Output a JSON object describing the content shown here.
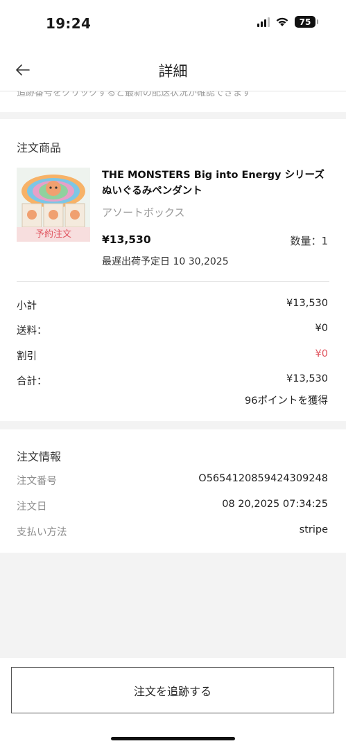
{
  "status_bar": {
    "time": "19:24",
    "battery": "75"
  },
  "nav": {
    "title": "詳細"
  },
  "peek_text": "追跡番号をクリックすると最新の配送状況が確認できます",
  "products": {
    "section_title": "注文商品",
    "item": {
      "name": "THE MONSTERS Big into Energy シリーズ ぬいぐるみペンダント",
      "variant": "アソートボックス",
      "badge": "予約注文",
      "price": "¥13,530",
      "quantity": "数量：1",
      "ship_date": "最遅出荷予定日 10 30,2025"
    },
    "summary": {
      "subtotal_label": "小計",
      "subtotal": "¥13,530",
      "shipping_label": "送料：",
      "shipping": "¥0",
      "discount_label": "割引",
      "discount": "¥0",
      "total_label": "合計：",
      "total": "¥13,530",
      "points": "96ポイントを獲得"
    }
  },
  "order_info": {
    "section_title": "注文情報",
    "rows": [
      {
        "label": "注文番号",
        "value": "O565412085942430924​8"
      },
      {
        "label": "注文日",
        "value": "08 20,2025 07:34:25"
      },
      {
        "label": "支払い方法",
        "value": "stripe"
      }
    ]
  },
  "actions": {
    "track_label": "注文を追跡する"
  },
  "colors": {
    "accent_red": "#e0555f",
    "background": "#f3f3f3"
  }
}
